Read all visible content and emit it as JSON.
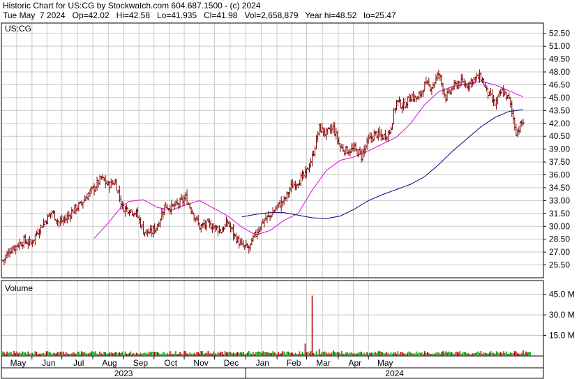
{
  "header": {
    "line1": "Historic Chart for US:CG by Stockwatch.com 604.687.1500 - (c) 2024",
    "line2": "Tue May  7 2024   Op=42.02   Hi=42.58   Lo=41.935   Cl=41.98   Vol=2,658,879   Year hi=48.52   lo=25.47"
  },
  "chart_data": {
    "type": "ohlc",
    "symbol_label": "US:CG",
    "volume_label": "Volume",
    "y_ticks": [
      "52.50",
      "51.00",
      "49.50",
      "48.00",
      "46.50",
      "45.00",
      "43.50",
      "42.00",
      "40.50",
      "39.00",
      "37.50",
      "36.00",
      "34.50",
      "33.00",
      "31.50",
      "30.00",
      "28.50",
      "27.00",
      "25.50"
    ],
    "ylim": [
      24.0,
      53.7
    ],
    "volume_ticks": [
      "45.0 M",
      "30.0 M",
      "15.0 M"
    ],
    "volume_ylim": [
      0,
      55
    ],
    "months": [
      "May",
      "Jun",
      "Jul",
      "Aug",
      "Sep",
      "Oct",
      "Nov",
      "Dec",
      "Jan",
      "Feb",
      "Mar",
      "Apr",
      "May"
    ],
    "years": [
      "2023",
      "2024"
    ],
    "grid": true,
    "colors": {
      "price_bar": "#800000",
      "ma_short": "#e000e0",
      "ma_long": "#000080",
      "volume": "#00a000",
      "volume_down": "#c00000",
      "grid": "#c8c8c8"
    },
    "price_path_weekly": [
      [
        0,
        26.0
      ],
      [
        1,
        27.2
      ],
      [
        2,
        27.8
      ],
      [
        3,
        28.3
      ],
      [
        4,
        28.0
      ],
      [
        5,
        29.5
      ],
      [
        6,
        30.6
      ],
      [
        7,
        31.7
      ],
      [
        8,
        30.4
      ],
      [
        9,
        30.9
      ],
      [
        10,
        31.9
      ],
      [
        11,
        32.5
      ],
      [
        12,
        33.6
      ],
      [
        13,
        34.5
      ],
      [
        14,
        35.6
      ],
      [
        15,
        34.8
      ],
      [
        16,
        35.2
      ],
      [
        17,
        32.2
      ],
      [
        18,
        32.0
      ],
      [
        19,
        31.5
      ],
      [
        20,
        29.5
      ],
      [
        21,
        29.2
      ],
      [
        22,
        30.1
      ],
      [
        23,
        32.4
      ],
      [
        24,
        32.2
      ],
      [
        25,
        32.6
      ],
      [
        26,
        33.3
      ],
      [
        27,
        31.7
      ],
      [
        28,
        29.9
      ],
      [
        29,
        30.2
      ],
      [
        30,
        30.0
      ],
      [
        31,
        29.5
      ],
      [
        32,
        30.4
      ],
      [
        33,
        28.8
      ],
      [
        34,
        27.7
      ],
      [
        35,
        27.4
      ],
      [
        36,
        29.2
      ],
      [
        37,
        30.6
      ],
      [
        38,
        31.2
      ],
      [
        39,
        32.3
      ],
      [
        40,
        33.0
      ],
      [
        41,
        34.6
      ],
      [
        42,
        35.3
      ],
      [
        43,
        36.0
      ],
      [
        44,
        38.0
      ],
      [
        45,
        41.5
      ],
      [
        46,
        40.8
      ],
      [
        47,
        41.5
      ],
      [
        48,
        39.2
      ],
      [
        49,
        38.8
      ],
      [
        50,
        39.0
      ],
      [
        51,
        38.3
      ],
      [
        52,
        40.0
      ],
      [
        53,
        40.8
      ],
      [
        54,
        40.4
      ],
      [
        55,
        41.0
      ],
      [
        56,
        44.6
      ],
      [
        57,
        44.0
      ],
      [
        58,
        45.2
      ],
      [
        59,
        44.8
      ],
      [
        60,
        46.5
      ],
      [
        61,
        46.3
      ],
      [
        62,
        47.8
      ],
      [
        63,
        45.0
      ],
      [
        64,
        46.2
      ],
      [
        65,
        46.8
      ],
      [
        66,
        46.5
      ],
      [
        67,
        47.2
      ],
      [
        68,
        47.4
      ],
      [
        69,
        45.5
      ],
      [
        70,
        44.2
      ],
      [
        71,
        45.8
      ],
      [
        72,
        44.8
      ],
      [
        73,
        41.0
      ],
      [
        74,
        42.2
      ]
    ],
    "ma_short_weekly": [
      [
        13,
        28.6
      ],
      [
        15,
        30.4
      ],
      [
        17,
        32.4
      ],
      [
        18,
        32.9
      ],
      [
        20,
        33.1
      ],
      [
        22,
        32.2
      ],
      [
        24,
        31.9
      ],
      [
        26,
        32.5
      ],
      [
        28,
        33.0
      ],
      [
        30,
        32.1
      ],
      [
        32,
        31.2
      ],
      [
        34,
        29.9
      ],
      [
        36,
        29.0
      ],
      [
        38,
        29.5
      ],
      [
        40,
        30.7
      ],
      [
        42,
        31.5
      ],
      [
        44,
        34.2
      ],
      [
        46,
        36.5
      ],
      [
        48,
        37.7
      ],
      [
        50,
        38.1
      ],
      [
        52,
        38.8
      ],
      [
        54,
        39.6
      ],
      [
        56,
        40.4
      ],
      [
        58,
        42.0
      ],
      [
        60,
        44.2
      ],
      [
        62,
        45.7
      ],
      [
        64,
        46.3
      ],
      [
        66,
        46.6
      ],
      [
        68,
        46.9
      ],
      [
        70,
        46.5
      ],
      [
        72,
        45.8
      ],
      [
        74,
        45.1
      ]
    ],
    "ma_long_weekly": [
      [
        34,
        31.1
      ],
      [
        36,
        31.4
      ],
      [
        38,
        31.6
      ],
      [
        40,
        31.6
      ],
      [
        42,
        31.3
      ],
      [
        44,
        31.0
      ],
      [
        46,
        30.9
      ],
      [
        48,
        31.2
      ],
      [
        50,
        32.0
      ],
      [
        52,
        33.0
      ],
      [
        54,
        33.7
      ],
      [
        56,
        34.3
      ],
      [
        58,
        34.9
      ],
      [
        60,
        35.8
      ],
      [
        62,
        37.2
      ],
      [
        64,
        38.8
      ],
      [
        66,
        40.2
      ],
      [
        68,
        41.6
      ],
      [
        70,
        42.7
      ],
      [
        72,
        43.4
      ],
      [
        74,
        43.6
      ]
    ],
    "volume_spike_weekly": [
      [
        43,
        9
      ],
      [
        44,
        44
      ],
      [
        45,
        5
      ],
      [
        47,
        4
      ],
      [
        60,
        3.5
      ],
      [
        74,
        4
      ],
      [
        75,
        3
      ]
    ]
  }
}
